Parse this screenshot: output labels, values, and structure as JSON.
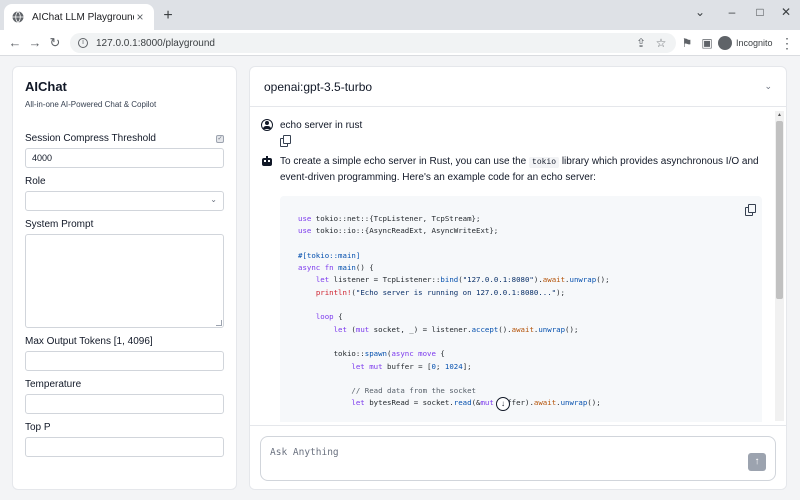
{
  "browser": {
    "tab_title": "AIChat LLM Playground",
    "url": "127.0.0.1:8000/playground",
    "incognito_label": "Incognito"
  },
  "sidebar": {
    "title": "AIChat",
    "subtitle": "All-in-one AI-Powered Chat & Copilot",
    "compress_label": "Session Compress Threshold",
    "compress_value": "4000",
    "compress_checked": true,
    "role_label": "Role",
    "role_value": "",
    "system_prompt_label": "System Prompt",
    "system_prompt_value": "",
    "max_tokens_label": "Max Output Tokens [1, 4096]",
    "max_tokens_value": "",
    "temperature_label": "Temperature",
    "temperature_value": "",
    "top_p_label": "Top P",
    "top_p_value": ""
  },
  "main": {
    "model": "openai:gpt-3.5-turbo",
    "user_message": "echo server in rust",
    "bot_intro_1": "To create a simple echo server in Rust, you can use the",
    "bot_code_word": "tokio",
    "bot_intro_2": "library which provides asynchronous I/O and event-driven programming. Here's an example code for an echo server:",
    "composer_placeholder": "Ask Anything"
  }
}
